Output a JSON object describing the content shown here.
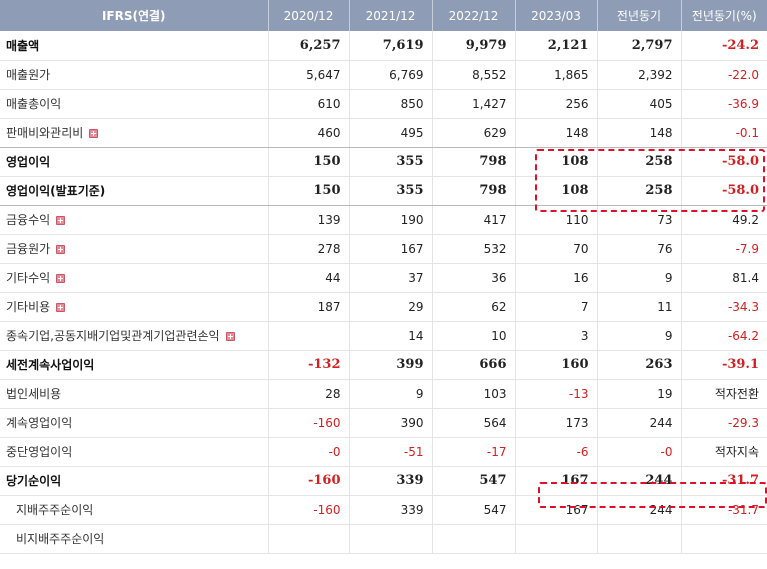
{
  "header": [
    "IFRS(연결)",
    "2020/12",
    "2021/12",
    "2022/12",
    "2023/03",
    "전년동기",
    "전년동기(%)"
  ],
  "rows": [
    {
      "label": "매출액",
      "values": [
        "6,257",
        "7,619",
        "9,979",
        "2,121",
        "2,797",
        "-24.2"
      ],
      "bold": true,
      "plus": false
    },
    {
      "label": "매출원가",
      "values": [
        "5,647",
        "6,769",
        "8,552",
        "1,865",
        "2,392",
        "-22.0"
      ],
      "bold": false,
      "plus": false
    },
    {
      "label": "매출총이익",
      "values": [
        "610",
        "850",
        "1,427",
        "256",
        "405",
        "-36.9"
      ],
      "bold": false,
      "plus": false
    },
    {
      "label": "판매비와관리비",
      "values": [
        "460",
        "495",
        "629",
        "148",
        "148",
        "-0.1"
      ],
      "bold": false,
      "plus": true
    },
    {
      "label": "영업이익",
      "values": [
        "150",
        "355",
        "798",
        "108",
        "258",
        "-58.0"
      ],
      "bold": true,
      "plus": false
    },
    {
      "label": "영업이익(발표기준)",
      "values": [
        "150",
        "355",
        "798",
        "108",
        "258",
        "-58.0"
      ],
      "bold": true,
      "plus": false
    },
    {
      "label": "금융수익",
      "values": [
        "139",
        "190",
        "417",
        "110",
        "73",
        "49.2"
      ],
      "bold": false,
      "plus": true
    },
    {
      "label": "금융원가",
      "values": [
        "278",
        "167",
        "532",
        "70",
        "76",
        "-7.9"
      ],
      "bold": false,
      "plus": true
    },
    {
      "label": "기타수익",
      "values": [
        "44",
        "37",
        "36",
        "16",
        "9",
        "81.4"
      ],
      "bold": false,
      "plus": true
    },
    {
      "label": "기타비용",
      "values": [
        "187",
        "29",
        "62",
        "7",
        "11",
        "-34.3"
      ],
      "bold": false,
      "plus": true
    },
    {
      "label": "종속기업,공동지배기업및관계기업관련손익",
      "values": [
        "",
        "14",
        "10",
        "3",
        "9",
        "-64.2"
      ],
      "bold": false,
      "plus": true
    },
    {
      "label": "세전계속사업이익",
      "values": [
        "-132",
        "399",
        "666",
        "160",
        "263",
        "-39.1"
      ],
      "bold": true,
      "plus": false
    },
    {
      "label": "법인세비용",
      "values": [
        "28",
        "9",
        "103",
        "-13",
        "19",
        "적자전환"
      ],
      "bold": false,
      "plus": false
    },
    {
      "label": "계속영업이익",
      "values": [
        "-160",
        "390",
        "564",
        "173",
        "244",
        "-29.3"
      ],
      "bold": false,
      "plus": false
    },
    {
      "label": "중단영업이익",
      "values": [
        "-0",
        "-51",
        "-17",
        "-6",
        "-0",
        "적자지속"
      ],
      "bold": false,
      "plus": false
    },
    {
      "label": "당기순이익",
      "values": [
        "-160",
        "339",
        "547",
        "167",
        "244",
        "-31.7"
      ],
      "bold": true,
      "plus": false
    },
    {
      "label": "지배주주순이익",
      "values": [
        "-160",
        "339",
        "547",
        "167",
        "244",
        "-31.7"
      ],
      "bold": false,
      "plus": false,
      "indent": true
    },
    {
      "label": "비지배주주순이익",
      "values": [
        "",
        "",
        "",
        "",
        "",
        ""
      ],
      "bold": false,
      "plus": false,
      "indent": true
    }
  ],
  "colors": {
    "header_bg": "#8e9cb5",
    "negative": "#d21f1f",
    "highlight": "#e0102a"
  }
}
